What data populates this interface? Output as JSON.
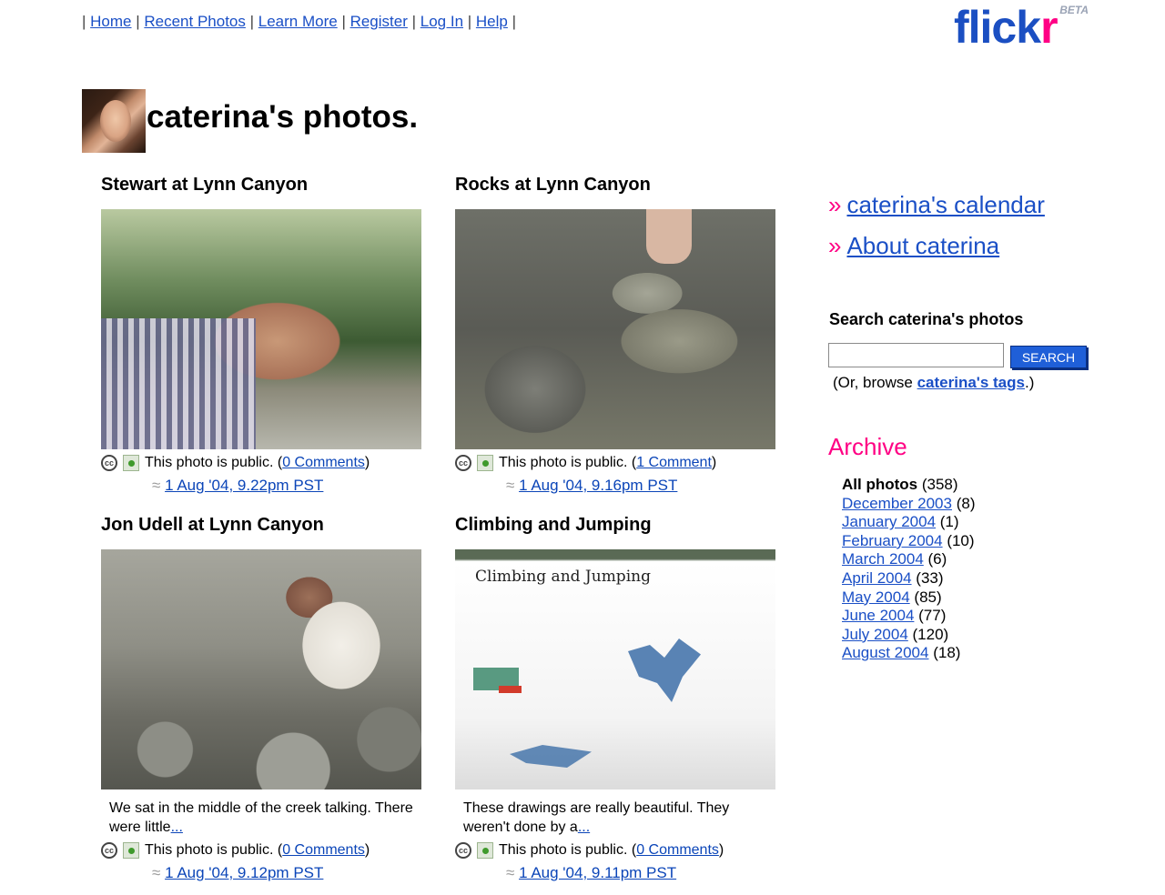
{
  "nav": {
    "items": [
      "Home",
      "Recent Photos",
      "Learn More",
      "Register",
      "Log In",
      "Help"
    ]
  },
  "logo": {
    "text_a": "flick",
    "text_b": "r",
    "beta": "BETA"
  },
  "page": {
    "title": "caterina's photos."
  },
  "photos": [
    {
      "title": "Stewart at Lynn Canyon",
      "privacy": "This photo is public. (",
      "comments": "0 Comments",
      "close": ")",
      "date": "1 Aug '04, 9.22pm PST",
      "desc": "",
      "more": ""
    },
    {
      "title": "Rocks at Lynn Canyon",
      "privacy": "This photo is public. (",
      "comments": "1 Comment",
      "close": ")",
      "date": "1 Aug '04, 9.16pm PST",
      "desc": "",
      "more": ""
    },
    {
      "title": "Jon Udell at Lynn Canyon",
      "privacy": "This photo is public. (",
      "comments": "0 Comments",
      "close": ")",
      "date": "1 Aug '04, 9.12pm PST",
      "desc": "We sat in the middle of the creek talking. There were little",
      "more": "..."
    },
    {
      "title": "Climbing and Jumping",
      "privacy": "This photo is public. (",
      "comments": "0 Comments",
      "close": ")",
      "date": "1 Aug '04, 9.11pm PST",
      "desc": "These drawings are really beautiful. They weren't done by a",
      "more": "..."
    }
  ],
  "sign_text": "Climbing and Jumping",
  "sidebar": {
    "calendar_link": "caterina's calendar",
    "about_link": "About caterina",
    "raquo": "»",
    "search_label": "Search caterina's photos",
    "search_button": "SEARCH",
    "browse_prefix": "(Or, browse ",
    "browse_link": "caterina's tags",
    "browse_suffix": ".)",
    "archive_title": "Archive",
    "archive": [
      {
        "label": "All photos",
        "count": "(358)"
      },
      {
        "label": "December 2003",
        "count": "(8)"
      },
      {
        "label": "January 2004",
        "count": "(1)"
      },
      {
        "label": "February 2004",
        "count": "(10)"
      },
      {
        "label": "March 2004",
        "count": "(6)"
      },
      {
        "label": "April 2004",
        "count": "(33)"
      },
      {
        "label": "May 2004",
        "count": "(85)"
      },
      {
        "label": "June 2004",
        "count": "(77)"
      },
      {
        "label": "July 2004",
        "count": "(120)"
      },
      {
        "label": "August 2004",
        "count": "(18)"
      }
    ]
  },
  "icons": {
    "cc": "cc",
    "wave": "≈"
  },
  "colors": {
    "link": "#1a4fc6",
    "accent_pink": "#ff0084",
    "button_blue": "#1f5fd8"
  }
}
